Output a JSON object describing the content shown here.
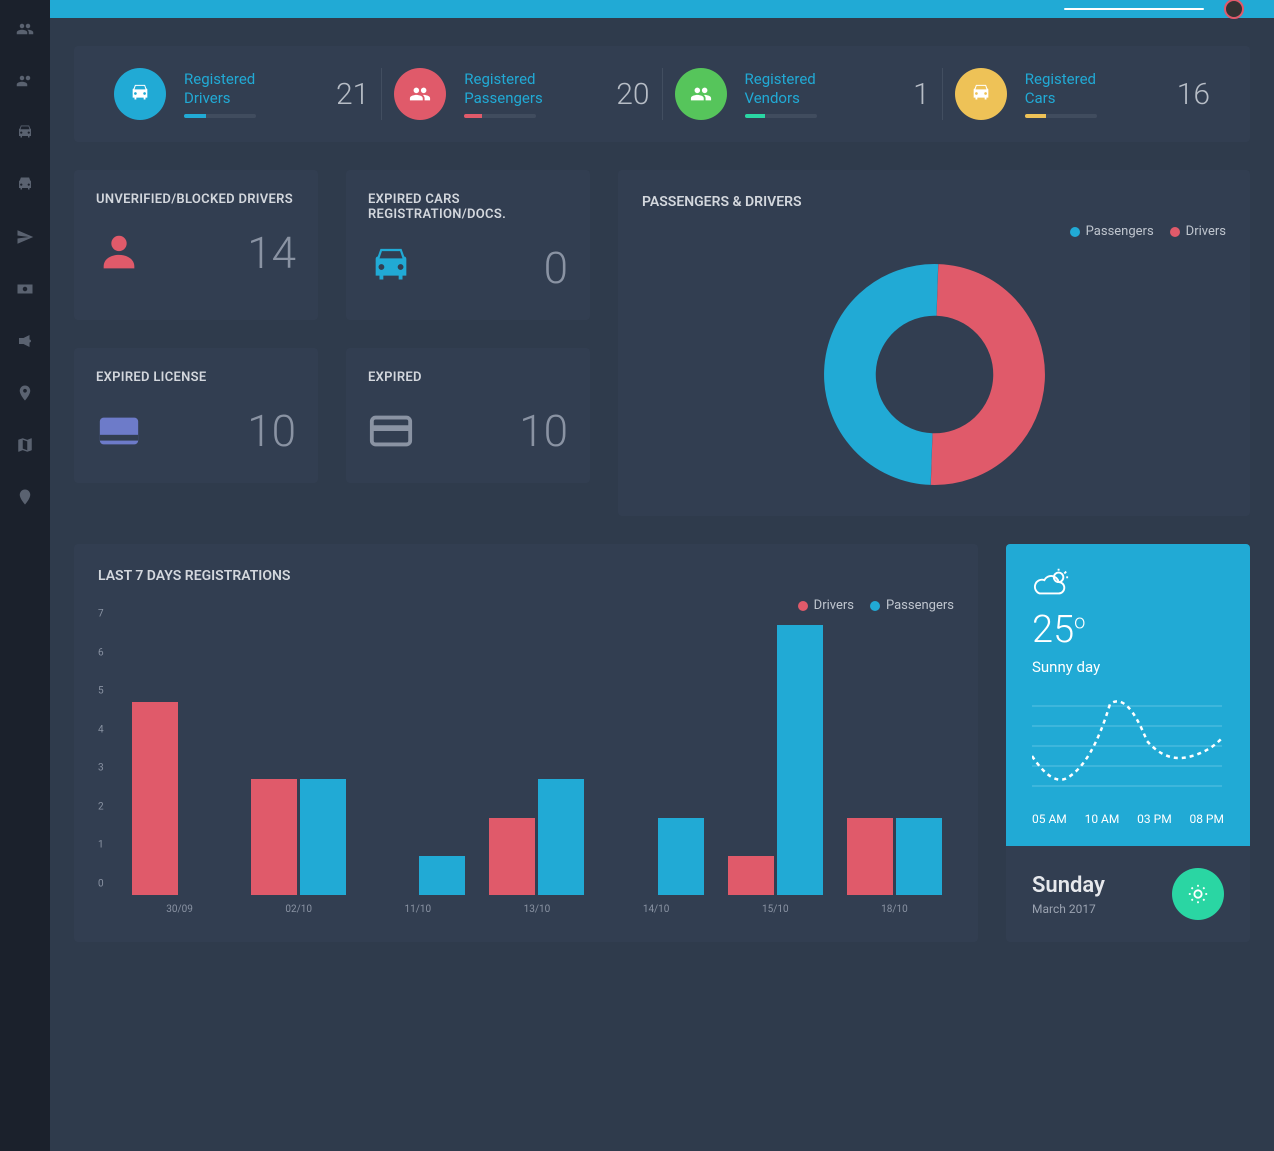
{
  "stats": [
    {
      "label": "Registered Drivers",
      "value": "21",
      "iconBg": "#21aad5",
      "barColor": "#21aad5",
      "barPct": 30
    },
    {
      "label": "Registered Passengers",
      "value": "20",
      "iconBg": "#e05a6a",
      "barColor": "#e05a6a",
      "barPct": 25
    },
    {
      "label": "Registered Vendors",
      "value": "1",
      "iconBg": "#56c55b",
      "barColor": "#2ad6a3",
      "barPct": 28
    },
    {
      "label": "Registered Cars",
      "value": "16",
      "iconBg": "#eec257",
      "barColor": "#eec257",
      "barPct": 30
    }
  ],
  "smallCards": {
    "unverified": {
      "title": "UNVERIFIED/BLOCKED DRIVERS",
      "value": "14"
    },
    "expiredCars": {
      "title": "EXPIRED CARS REGISTRATION/DOCS.",
      "value": "0"
    },
    "expiredLicense": {
      "title": "EXPIRED LICENSE",
      "value": "10"
    },
    "expired": {
      "title": "EXPIRED",
      "value": "10"
    }
  },
  "donut": {
    "title": "PASSENGERS & DRIVERS",
    "legend": [
      {
        "label": "Passengers",
        "color": "#21aad5"
      },
      {
        "label": "Drivers",
        "color": "#e05a6a"
      }
    ]
  },
  "barChart": {
    "title": "LAST 7 DAYS REGISTRATIONS",
    "legend": [
      {
        "label": "Drivers",
        "color": "#e05a6a"
      },
      {
        "label": "Passengers",
        "color": "#21aad5"
      }
    ],
    "yTicks": [
      "0",
      "1",
      "2",
      "3",
      "4",
      "5",
      "6",
      "7"
    ]
  },
  "weather": {
    "temp": "25",
    "desc": "Sunny day",
    "times": [
      "05 AM",
      "10 AM",
      "03 PM",
      "08 PM"
    ],
    "day": "Sunday",
    "date": "March 2017"
  },
  "chart_data": [
    {
      "type": "pie",
      "title": "PASSENGERS & DRIVERS",
      "series": [
        {
          "name": "Passengers",
          "value": 20
        },
        {
          "name": "Drivers",
          "value": 21
        }
      ]
    },
    {
      "type": "bar",
      "title": "LAST 7 DAYS REGISTRATIONS",
      "categories": [
        "30/09",
        "02/10",
        "11/10",
        "13/10",
        "14/10",
        "15/10",
        "18/10"
      ],
      "series": [
        {
          "name": "Drivers",
          "values": [
            5,
            3,
            0,
            2,
            0,
            1,
            2
          ]
        },
        {
          "name": "Passengers",
          "values": [
            0,
            3,
            1,
            3,
            2,
            7,
            2
          ]
        }
      ],
      "ylim": [
        0,
        7
      ],
      "ylabel": "",
      "xlabel": ""
    }
  ]
}
